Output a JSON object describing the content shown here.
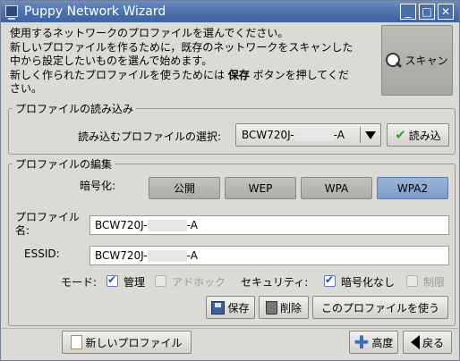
{
  "window": {
    "title": "Puppy Network Wizard",
    "controls": {
      "minimize": "_",
      "maximize": "□",
      "close": "✕"
    }
  },
  "intro": {
    "line1": "使用するネットワークのプロファイルを選んでください。",
    "line2": "新しいプロファイルを作るために，既存のネットワークをスキャンした",
    "line3": "中から設定したいものを選んで始めます。",
    "line4_pre": "新しく作られたプロファイルを使うためには ",
    "line4_bold": "保存",
    "line4_post": " ボタンを押してくだ",
    "line5": "さい。"
  },
  "scan_button": {
    "label": "スキャン",
    "icon": "magnifier-icon"
  },
  "load_section": {
    "legend": "プロファイルの読み込み",
    "select_label": "読み込むプロファイルの選択:",
    "selected_prefix": "BCW720J-",
    "selected_suffix": "-A",
    "load_button": "読み込"
  },
  "edit_section": {
    "legend": "プロファイルの編集",
    "encryption_label": "暗号化:",
    "encryption_options": [
      "公開",
      "WEP",
      "WPA",
      "WPA2"
    ],
    "encryption_selected": "WPA2",
    "profile_name_label_1": "プロファイル",
    "profile_name_label_2": "名:",
    "profile_name_prefix": "BCW720J-",
    "profile_name_suffix": "-A",
    "essid_label": "ESSID:",
    "essid_prefix": "BCW720J-",
    "essid_suffix": "-A",
    "mode_label": "モード:",
    "mode_managed": "管理",
    "mode_adhoc": "アドホック",
    "security_label": "セキュリティ:",
    "security_no_encryption": "暗号化なし",
    "security_restricted": "制限",
    "save_button": "保存",
    "delete_button": "削除",
    "use_profile_button": "このプロファイルを使う"
  },
  "footer": {
    "new_profile_button": "新しいプロファイル",
    "advanced_button": "高度",
    "back_button": "戻る"
  },
  "colors": {
    "titlebar": "#4a6ea8",
    "active_encryption": "#8aa6d2",
    "window_bg": "#dcdad5"
  }
}
